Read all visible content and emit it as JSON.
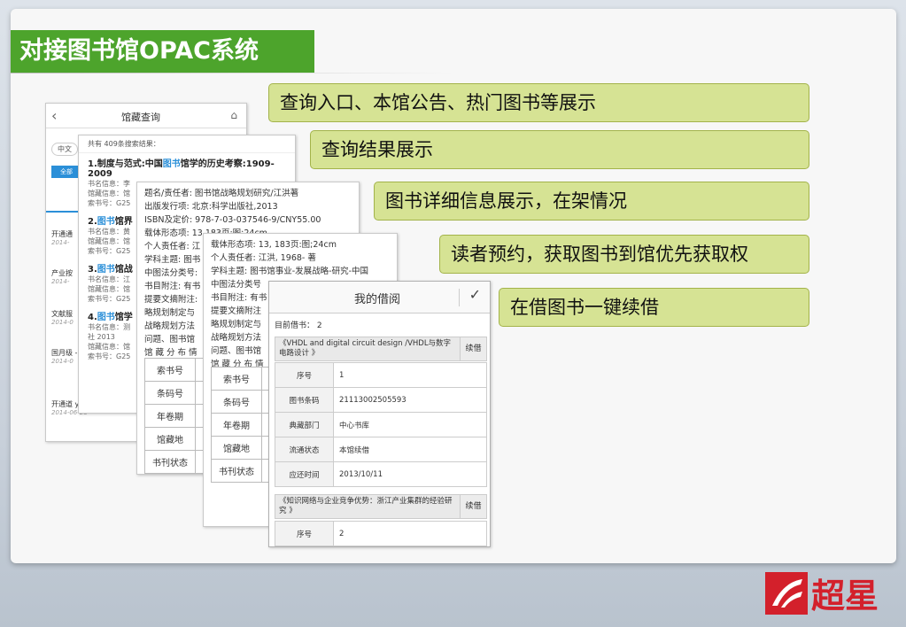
{
  "slide": {
    "title": "对接图书馆OPAC系统",
    "callouts": [
      "查询入口、本馆公告、热门图书等展示",
      "查询结果展示",
      "图书详细信息展示，在架情况",
      "读者预约，获取图书到馆优先获取权",
      "在借图书一键续借"
    ],
    "logo_text": "超星"
  },
  "search_screen": {
    "title": "馆藏查询",
    "back_icon": "‹",
    "chip": "中文",
    "btn": "全部",
    "news": [
      {
        "t": "开通通",
        "d": "2014-"
      },
      {
        "t": "产业按",
        "d": "2014-"
      },
      {
        "t": "文献服",
        "d": "2014-0"
      },
      {
        "t": "国月级 -13:30",
        "d": "2014-0"
      },
      {
        "t": "开通道 y电子图书数据库",
        "d": "2014-06-28"
      }
    ]
  },
  "results_screen": {
    "header": "共有 409条搜索结果：",
    "items": [
      {
        "pre": "1.制度与范式:中国",
        "hl": "图书",
        "post": "馆学的历史考察:1909-2009",
        "meta": [
          "书名信息：李",
          "馆藏信息：馆",
          "索书号：G25"
        ]
      },
      {
        "pre": "2.",
        "hl": "图书",
        "post": "馆界",
        "meta": [
          "书名信息：黄",
          "馆藏信息：馆",
          "索书号：G25"
        ]
      },
      {
        "pre": "3.",
        "hl": "图书",
        "post": "馆战",
        "meta": [
          "书名信息：江",
          "馆藏信息：馆",
          "索书号：G25"
        ]
      },
      {
        "pre": "4.",
        "hl": "图书",
        "post": "馆学",
        "meta": [
          "书名信息：测",
          "社 2013",
          "馆藏信息：馆",
          "索书号：G25"
        ]
      }
    ]
  },
  "detail_screen": {
    "lines": [
      "题名/责任者: 图书馆战略规划研究/江洪著",
      "出版发行项: 北京:科学出版社,2013",
      "ISBN及定价: 978-7-03-037546-9/CNY55.00",
      "载体形态项: 13,183页:图;24cm",
      "个人责任者: 江",
      "学科主题: 图书",
      "中图法分类号:",
      "书目附注: 有书",
      "提要文摘附注:",
      "略规划制定与",
      "战略规划方法",
      "问题、图书馆",
      "馆 藏 分 布 情"
    ],
    "table": [
      "索书号",
      "条码号",
      "年卷期",
      "馆藏地",
      "书刊状态"
    ]
  },
  "detail_screen2": {
    "lines": [
      "载体形态项: 13, 183页:图;24cm",
      "个人责任者: 江洪, 1968- 著",
      "学科主题: 图书馆事业-发展战略-研究-中国",
      "中图法分类号",
      "书目附注: 有书",
      "提要文摘附注",
      "略规划制定与",
      "战略规划方法",
      "问题、图书馆",
      "馆 藏 分 布 情"
    ],
    "table": [
      "索书号",
      "条码号",
      "年卷期",
      "馆藏地",
      "书刊状态"
    ]
  },
  "borrow_screen": {
    "title": "我的借阅",
    "count": "目前借书： 2",
    "renew": "续借",
    "books": [
      {
        "name": "《VHDL and digital circuit design /VHDL与数字电路设计 》",
        "rows": [
          [
            "序号",
            "1"
          ],
          [
            "图书条码",
            "21113002505593"
          ],
          [
            "典藏部门",
            "中心书库"
          ],
          [
            "流通状态",
            "本馆续借"
          ],
          [
            "应还时间",
            "2013/10/11"
          ]
        ]
      },
      {
        "name": "《知识网络与企业竞争优势：浙江产业集群的经验研究 》",
        "rows": [
          [
            "序号",
            "2"
          ]
        ]
      }
    ]
  }
}
